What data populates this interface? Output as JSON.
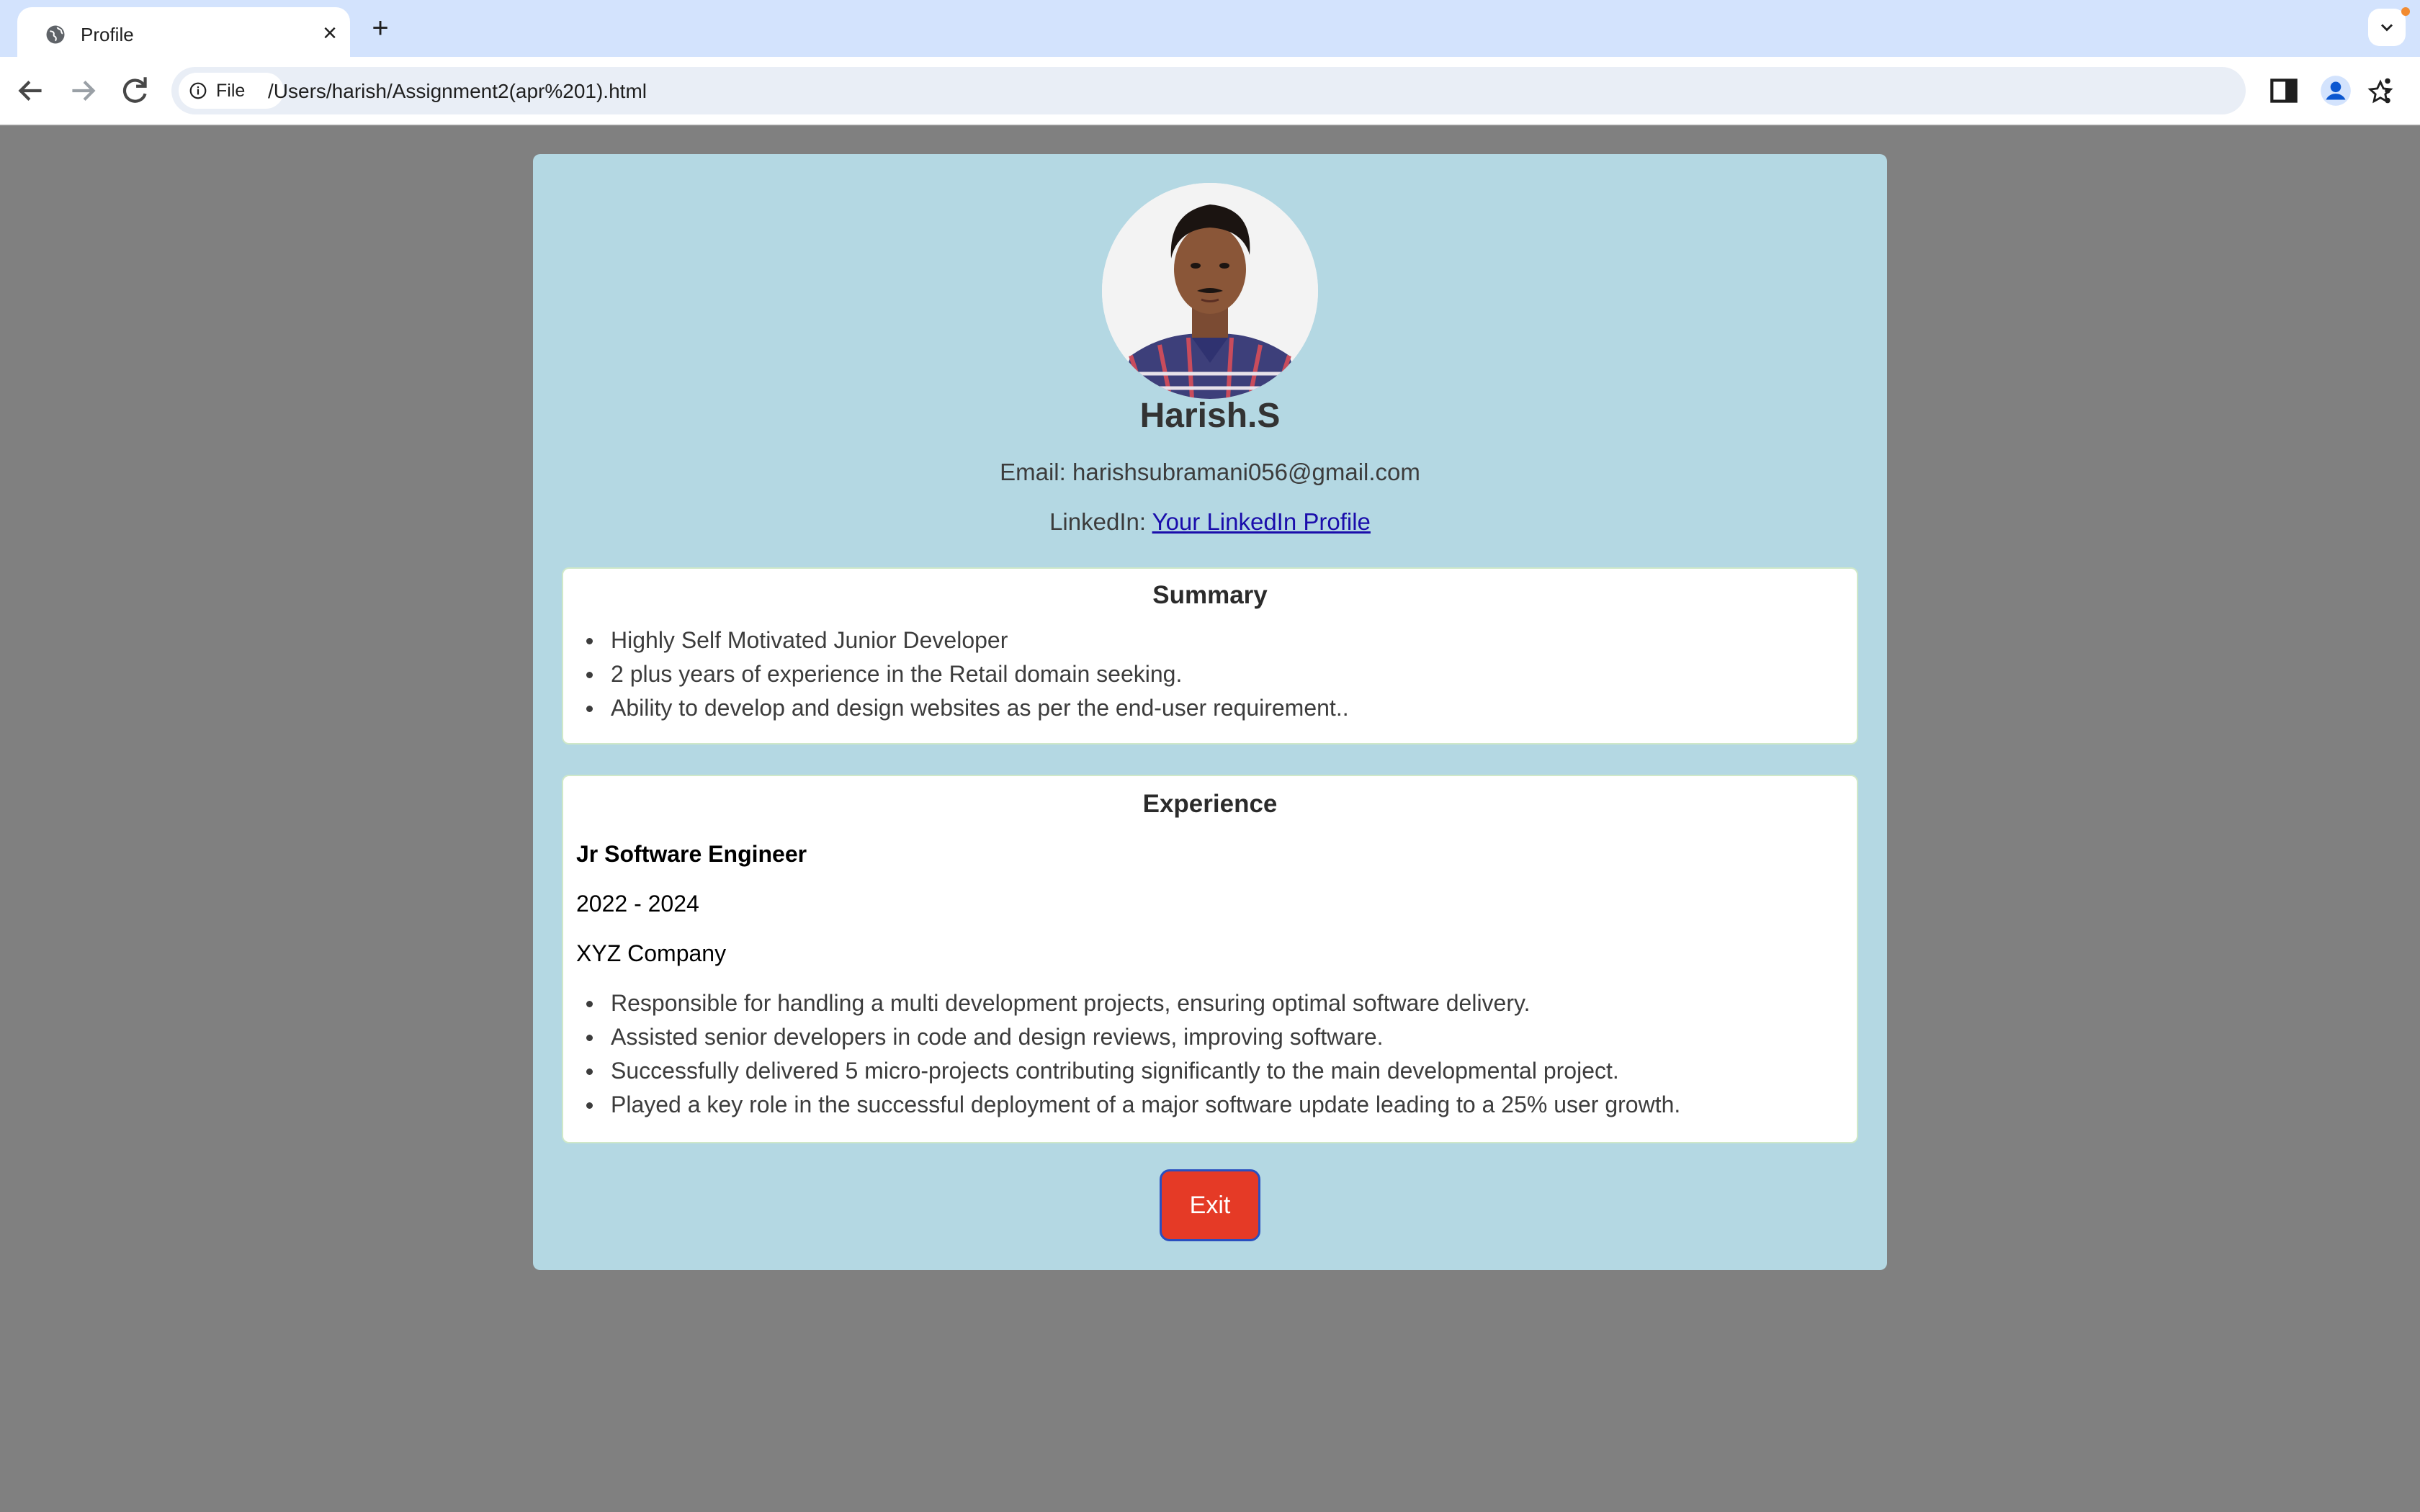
{
  "browser": {
    "tab": {
      "title": "Profile",
      "favicon": "globe-icon",
      "close": "×"
    },
    "new_tab": "+",
    "address_bar": {
      "chip_label": "File",
      "url": "/Users/harish/Assignment2(apr%201).html"
    },
    "icons": [
      "back-icon",
      "forward-icon",
      "reload-icon",
      "info-icon",
      "star-icon",
      "side-panel-icon",
      "profile-icon",
      "menu-icon",
      "tab-search-icon"
    ]
  },
  "profile": {
    "name": "Harish.S",
    "email_label": "Email:",
    "email": "harishsubramani056@gmail.com",
    "linkedin_label": "LinkedIn:",
    "linkedin_link": "Your LinkedIn Profile"
  },
  "summary": {
    "title": "Summary",
    "items": [
      "Highly Self Motivated Junior Developer",
      "2 plus years of experience in the Retail domain seeking.",
      "Ability to develop and design websites as per the end-user requirement.."
    ]
  },
  "experience": {
    "title": "Experience",
    "role": "Jr Software Engineer",
    "years": "2022 - 2024",
    "company": "XYZ Company",
    "items": [
      "Responsible for handling a multi development projects, ensuring optimal software delivery.",
      "Assisted senior developers in code and design reviews, improving software.",
      "Successfully delivered 5 micro-projects contributing significantly to the main developmental project.",
      "Played a key role in the successful deployment of a major software update leading to a 25% user growth."
    ]
  },
  "exit_button": "Exit",
  "colors": {
    "page_background": "#808080",
    "card_background": "#b4d8e3",
    "exit_button": "#e53a26",
    "link": "#1a0dab"
  }
}
